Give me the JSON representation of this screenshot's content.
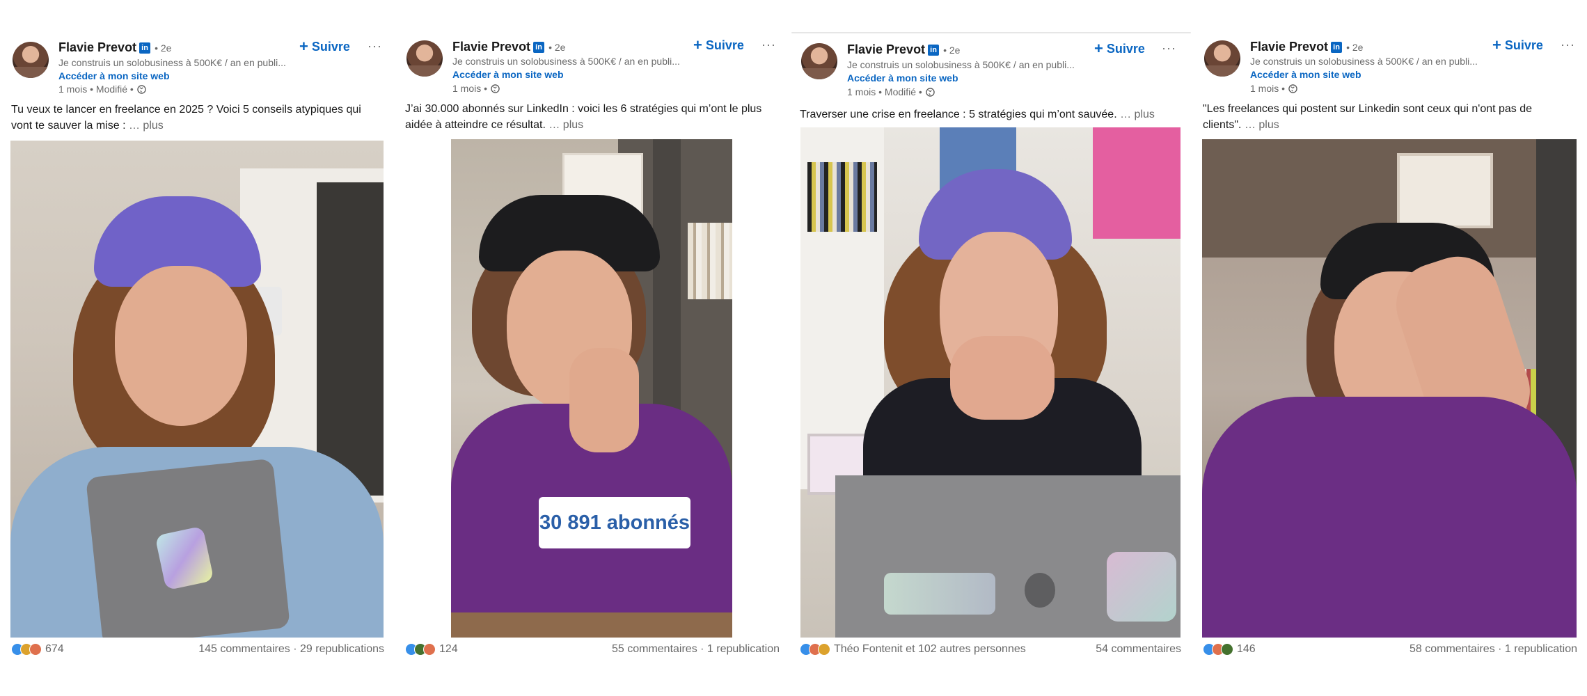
{
  "author": {
    "name": "Flavie Prevot",
    "badge": "in",
    "degree": "• 2e",
    "headline": "Je construis un solobusiness à 500K€ / an en publi...",
    "site_link": "Accéder à mon site web",
    "follow_label": "Suivre",
    "more_label": "···"
  },
  "colors": {
    "link": "#0a66c2",
    "secondary_text": "#666666",
    "primary_text": "#191919"
  },
  "posts": [
    {
      "meta": "1 mois • Modifié •",
      "text_line1": "Tu veux te lancer en freelance en 2025 ? Voici 5 conseils atypiques qui",
      "text_line2": "vont te sauver la mise :",
      "more": "… plus",
      "reactions": [
        "like",
        "support",
        "love"
      ],
      "reaction_count": "674",
      "stats": "145 commentaires · 29 republications",
      "image_icon": "laptop-sticker-photo"
    },
    {
      "meta": "1 mois •",
      "text_line1": "J’ai 30.000 abonnés sur LinkedIn : voici les 6 stratégies qui m’ont le plus",
      "text_line2": "aidée à atteindre ce résultat.",
      "more": "… plus",
      "overlay": "30 891 abonnés",
      "reactions": [
        "like",
        "celebrate",
        "love"
      ],
      "reaction_count": "124",
      "stats": "55 commentaires · 1 republication"
    },
    {
      "meta": "1 mois • Modifié •",
      "text_line1": "Traverser une crise en freelance : 5 stratégies qui m’ont sauvée.",
      "more": "… plus",
      "reactions": [
        "like",
        "love",
        "support"
      ],
      "reaction_count": "Théo Fontenit et 102 autres personnes",
      "stats": "54 commentaires"
    },
    {
      "meta": "1 mois •",
      "text_line1": "\"Les freelances qui postent sur Linkedin sont ceux qui n'ont pas de",
      "text_line2": "clients\".",
      "more": "… plus",
      "reactions": [
        "like",
        "love",
        "celebrate"
      ],
      "reaction_count": "146",
      "stats": "58 commentaires · 1 republication"
    }
  ]
}
